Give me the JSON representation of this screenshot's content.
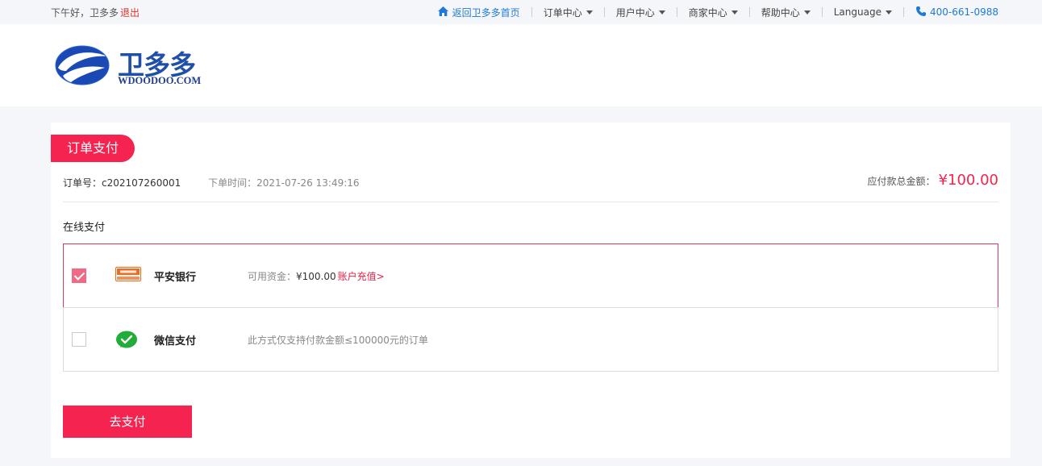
{
  "topbar": {
    "greeting": "下午好，卫多多",
    "logout": "退出",
    "nav": {
      "home": "返回卫多多首页",
      "orders": "订单中心",
      "user": "用户中心",
      "merchant": "商家中心",
      "help": "帮助中心",
      "language": "Language",
      "phone": "400-661-0988"
    }
  },
  "logo": {
    "name": "卫多多",
    "domain": "WDOODOO.COM"
  },
  "payment": {
    "title": "订单支付",
    "order_no_label": "订单号：",
    "order_no": "c202107260001",
    "order_time_label": "下单时间：",
    "order_time": "2021-07-26 13:49:16",
    "total_label": "应付款总金额：",
    "total_amount": "¥100.00",
    "section_title": "在线支付",
    "methods": [
      {
        "name": "平安银行",
        "icon": "pingan-bank-icon",
        "desc_label": "可用资金：",
        "desc_value": "¥100.00",
        "desc_link": "账户充值>",
        "selected": true
      },
      {
        "name": "微信支付",
        "icon": "wechat-pay-icon",
        "desc": "此方式仅支持付款金额≤100000元的订单",
        "selected": false
      }
    ],
    "submit_label": "去支付"
  },
  "colors": {
    "accent": "#f52350",
    "link": "#1f7ad6",
    "selected_border": "#d9385b",
    "brand_blue": "#1f4fa8"
  }
}
